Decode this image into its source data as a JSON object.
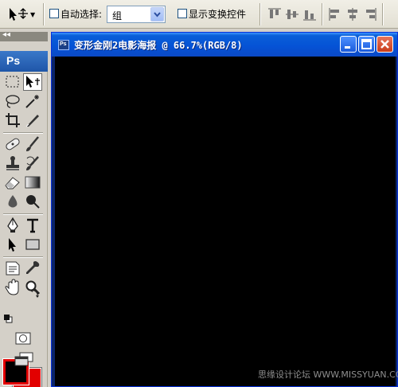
{
  "options_bar": {
    "auto_select_label": "自动选择:",
    "auto_select_value": "组",
    "show_transform_label": "显示变换控件"
  },
  "toolbox": {
    "logo": "Ps",
    "collapse_glyph": "◂◂",
    "foreground_color": "#000000",
    "background_color": "#e20000"
  },
  "document": {
    "title": "变形金刚2电影海报 @ 66.7%(RGB/8)",
    "icon_label": "Ps"
  },
  "watermark": "思缘设计论坛 WWW.MISSYUAN.COM"
}
